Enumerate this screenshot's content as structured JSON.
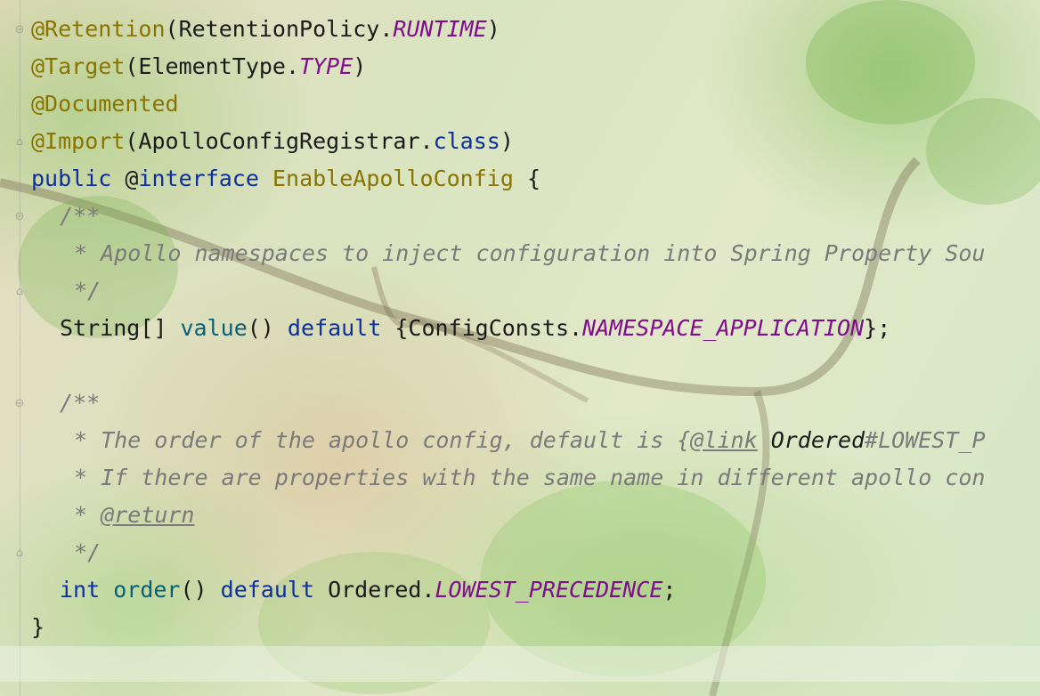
{
  "editor": {
    "language": "Java",
    "lines": [
      {
        "annotation": "@Retention",
        "open": "(",
        "type": "RetentionPolicy",
        "dot": ".",
        "constant": "RUNTIME",
        "close": ")"
      },
      {
        "annotation": "@Target",
        "open": "(",
        "type": "ElementType",
        "dot": ".",
        "constant": "TYPE",
        "close": ")"
      },
      {
        "annotation": "@Documented"
      },
      {
        "annotation": "@Import",
        "open": "(",
        "type": "ApolloConfigRegistrar",
        "dot": ".",
        "keyword": "class",
        "close": ")"
      },
      {
        "kw1": "public",
        "at": "@",
        "kw2": "interface",
        "name": "EnableApolloConfig",
        "brace": "{"
      },
      {
        "comment": "/**"
      },
      {
        "comment": "* Apollo namespaces to inject configuration into Spring Property Sou"
      },
      {
        "comment": "*/"
      },
      {
        "type": "String[]",
        "method": "value",
        "parens": "()",
        "keyword": "default",
        "open": "{ConfigConsts.",
        "constant": "NAMESPACE_APPLICATION",
        "close": "};"
      },
      {
        "blank": ""
      },
      {
        "comment": "/**"
      },
      {
        "comment_pre": "* The order of the apollo config, default is {",
        "tag": "@link",
        "ref": "Ordered",
        "comment_post": "#LOWEST_P"
      },
      {
        "comment": "* If there are properties with the same name in different apollo con"
      },
      {
        "comment_pre": "* ",
        "tag": "@return"
      },
      {
        "comment": "*/"
      },
      {
        "keyword": "int",
        "method": "order",
        "parens": "()",
        "keyword2": "default",
        "type": "Ordered",
        "dot": ".",
        "constant": "LOWEST_PRECEDENCE",
        "close": ";"
      },
      {
        "brace": "}"
      }
    ]
  },
  "fold_marker_icon": "fold-arrow-icon",
  "colors": {
    "annotation": "#8a7400",
    "keyword": "#0b2f9c",
    "constant": "#7f0e8c",
    "method": "#0a5f78",
    "comment": "#7a7a7a",
    "text": "#1b1b1b"
  }
}
